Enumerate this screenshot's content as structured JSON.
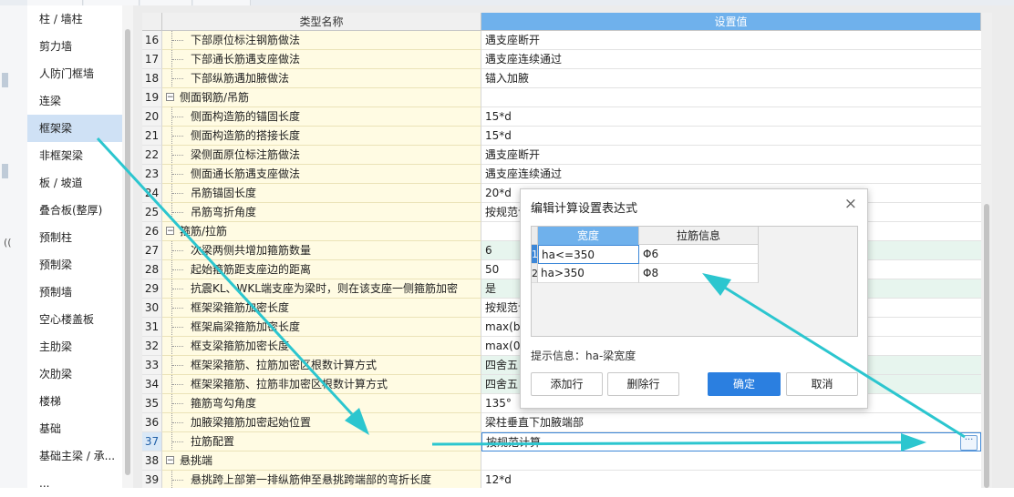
{
  "sidebar": {
    "items": [
      "柱 / 墙柱",
      "剪力墙",
      "人防门框墙",
      "连梁",
      "框架梁",
      "非框架梁",
      "板 / 坡道",
      "叠合板(整厚)",
      "预制柱",
      "预制梁",
      "预制墙",
      "空心楼盖板",
      "主肋梁",
      "次肋梁",
      "楼梯",
      "基础",
      "基础主梁 / 承...",
      "..."
    ],
    "selected_index": 4
  },
  "table": {
    "col_name": "类型名称",
    "col_value": "设置值",
    "rows": [
      {
        "n": "16",
        "name": "下部原位标注钢筋做法",
        "value": "遇支座断开",
        "group": false,
        "green": false
      },
      {
        "n": "17",
        "name": "下部通长筋遇支座做法",
        "value": "遇支座连续通过",
        "group": false,
        "green": false
      },
      {
        "n": "18",
        "name": "下部纵筋遇加腋做法",
        "value": "锚入加腋",
        "group": false,
        "green": false
      },
      {
        "n": "19",
        "name": "侧面钢筋/吊筋",
        "value": "",
        "group": true,
        "green": false
      },
      {
        "n": "20",
        "name": "侧面构造筋的锚固长度",
        "value": "15*d",
        "group": false,
        "green": false
      },
      {
        "n": "21",
        "name": "侧面构造筋的搭接长度",
        "value": "15*d",
        "group": false,
        "green": false
      },
      {
        "n": "22",
        "name": "梁侧面原位标注筋做法",
        "value": "遇支座断开",
        "group": false,
        "green": false
      },
      {
        "n": "23",
        "name": "侧面通长筋遇支座做法",
        "value": "遇支座连续通过",
        "group": false,
        "green": false
      },
      {
        "n": "24",
        "name": "吊筋锚固长度",
        "value": "20*d",
        "group": false,
        "green": false
      },
      {
        "n": "25",
        "name": "吊筋弯折角度",
        "value": "按规范计",
        "group": false,
        "green": false
      },
      {
        "n": "26",
        "name": "箍筋/拉筋",
        "value": "",
        "group": true,
        "green": false
      },
      {
        "n": "27",
        "name": "次梁两侧共增加箍筋数量",
        "value": "6",
        "group": false,
        "green": true
      },
      {
        "n": "28",
        "name": "起始箍筋距支座边的距离",
        "value": "50",
        "group": false,
        "green": false
      },
      {
        "n": "29",
        "name": "抗震KL、WKL端支座为梁时，则在该支座一侧箍筋加密",
        "value": "是",
        "group": false,
        "green": true
      },
      {
        "n": "30",
        "name": "框架梁箍筋加密长度",
        "value": "按规范计",
        "group": false,
        "green": false
      },
      {
        "n": "31",
        "name": "框架扁梁箍筋加密长度",
        "value": "max(b",
        "group": false,
        "green": false
      },
      {
        "n": "32",
        "name": "框支梁箍筋加密长度",
        "value": "max(0.",
        "group": false,
        "green": false
      },
      {
        "n": "33",
        "name": "框架梁箍筋、拉筋加密区根数计算方式",
        "value": "四舍五",
        "group": false,
        "green": true
      },
      {
        "n": "34",
        "name": "框架梁箍筋、拉筋非加密区根数计算方式",
        "value": "四舍五",
        "group": false,
        "green": true
      },
      {
        "n": "35",
        "name": "箍筋弯勾角度",
        "value": "135°",
        "group": false,
        "green": false
      },
      {
        "n": "36",
        "name": "加腋梁箍筋加密起始位置",
        "value": "梁柱垂直下加腋端部",
        "group": false,
        "green": false
      },
      {
        "n": "37",
        "name": "拉筋配置",
        "value": "按规范计算",
        "group": false,
        "green": false,
        "current": true
      },
      {
        "n": "38",
        "name": "悬挑端",
        "value": "",
        "group": true,
        "green": false
      },
      {
        "n": "39",
        "name": "悬挑跨上部第一排纵筋伸至悬挑跨端部的弯折长度",
        "value": "12*d",
        "group": false,
        "green": false
      }
    ],
    "ellipsis": "···"
  },
  "dialog": {
    "title": "编辑计算设置表达式",
    "close": "×",
    "col_width": "宽度",
    "col_tie": "拉筋信息",
    "rows": [
      {
        "n": "1",
        "width": "ha<=350",
        "tie": "Φ6"
      },
      {
        "n": "2",
        "width": "ha>350",
        "tie": "Φ8"
      }
    ],
    "hint": "提示信息：ha-梁宽度",
    "add_row": "添加行",
    "delete_row": "删除行",
    "ok": "确定",
    "cancel": "取消"
  },
  "leftedge": {
    "glyph": "(("
  },
  "colors": {
    "accent": "#6fb1ec",
    "primary_button": "#2b7fe0",
    "arrow": "#2cc6cf",
    "selected": "#cfe1f5"
  }
}
